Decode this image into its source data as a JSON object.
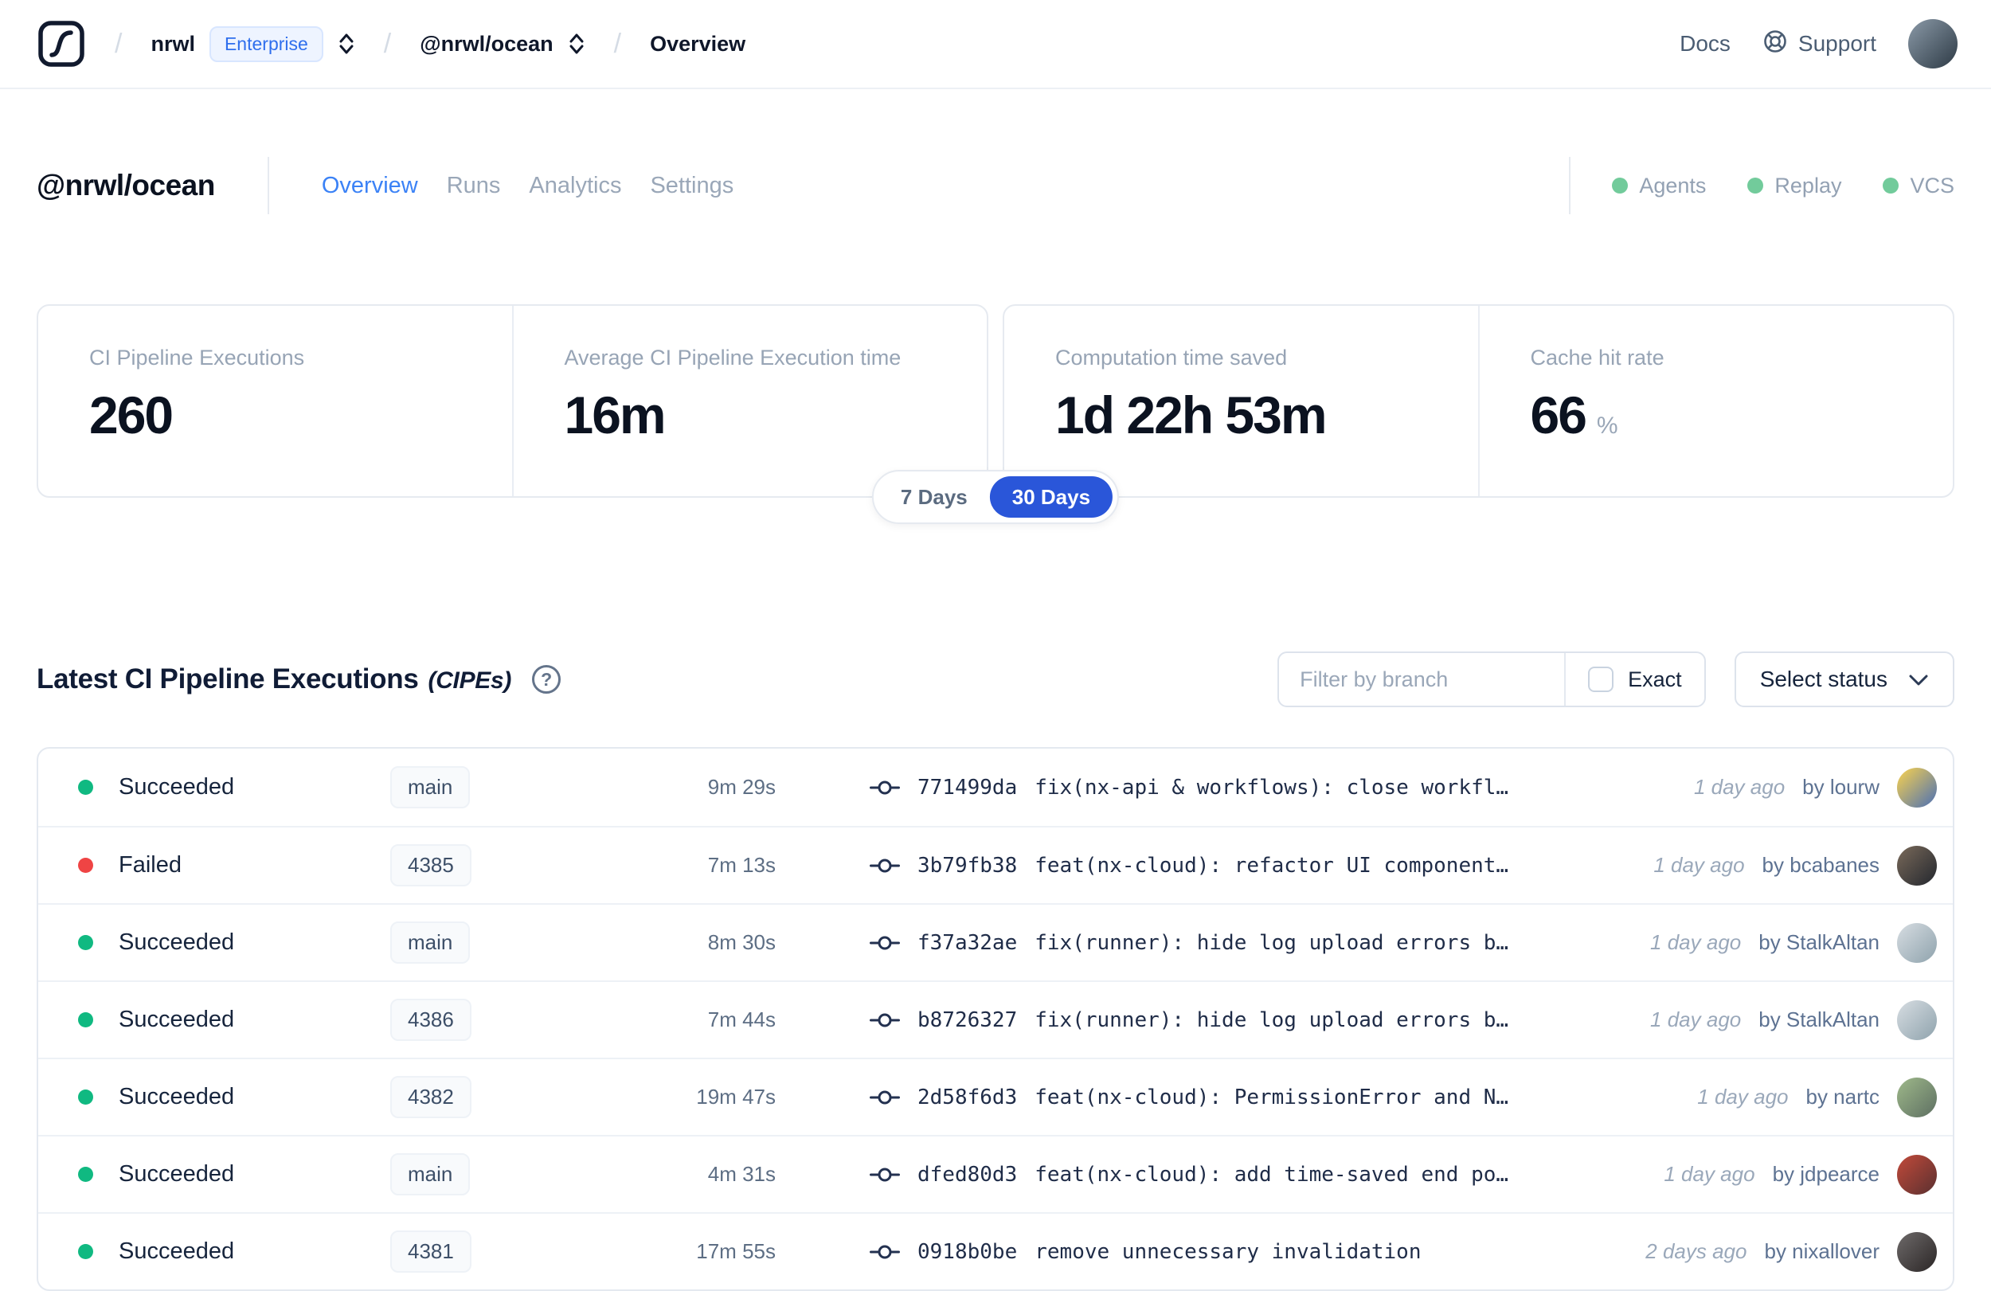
{
  "navbar": {
    "logo_name": "nx-cloud-logo",
    "breadcrumb": {
      "org": "nrwl",
      "org_badge": "Enterprise",
      "workspace": "@nrwl/ocean",
      "page": "Overview"
    },
    "docs_label": "Docs",
    "support_label": "Support",
    "avatar_from": "#8b9aa8",
    "avatar_to": "#2d3a45"
  },
  "header": {
    "title": "@nrwl/ocean",
    "tabs": [
      {
        "label": "Overview",
        "active": true
      },
      {
        "label": "Runs",
        "active": false
      },
      {
        "label": "Analytics",
        "active": false
      },
      {
        "label": "Settings",
        "active": false
      }
    ],
    "indicators": [
      {
        "label": "Agents",
        "color": "#72cb9b"
      },
      {
        "label": "Replay",
        "color": "#72cb9b"
      },
      {
        "label": "VCS",
        "color": "#72cb9b"
      }
    ]
  },
  "stats": {
    "cards": [
      {
        "label": "CI Pipeline Executions",
        "value": "260",
        "suffix": ""
      },
      {
        "label": "Average CI Pipeline Execution time",
        "value": "16m",
        "suffix": ""
      },
      {
        "label": "Computation time saved",
        "value": "1d 22h 53m",
        "suffix": ""
      },
      {
        "label": "Cache hit rate",
        "value": "66",
        "suffix": "%"
      }
    ],
    "range_toggle": {
      "options": [
        "7 Days",
        "30 Days"
      ],
      "selected": "30 Days",
      "selected_color": "#2a56d9"
    }
  },
  "cipe_section": {
    "title": "Latest CI Pipeline Executions",
    "title_suffix": "(CIPEs)",
    "filter_placeholder": "Filter by branch",
    "exact_label": "Exact",
    "exact_checked": false,
    "status_dropdown_label": "Select status"
  },
  "table": {
    "rows": [
      {
        "status": "Succeeded",
        "status_color": "#10b981",
        "branch": "main",
        "duration": "9m 29s",
        "commit_hash": "771499da",
        "commit_message": "fix(nx-api & workflows): close workfl…",
        "time_ago": "1 day ago",
        "author": "by lourw",
        "avatar_from": "#fbd34d",
        "avatar_to": "#4a6fb5"
      },
      {
        "status": "Failed",
        "status_color": "#ef4444",
        "branch": "4385",
        "duration": "7m 13s",
        "commit_hash": "3b79fb38",
        "commit_message": "feat(nx-cloud): refactor UI component…",
        "time_ago": "1 day ago",
        "author": "by bcabanes",
        "avatar_from": "#7a6a5a",
        "avatar_to": "#23272e"
      },
      {
        "status": "Succeeded",
        "status_color": "#10b981",
        "branch": "main",
        "duration": "8m 30s",
        "commit_hash": "f37a32ae",
        "commit_message": "fix(runner): hide log upload errors b…",
        "time_ago": "1 day ago",
        "author": "by StalkAltan",
        "avatar_from": "#d7dde2",
        "avatar_to": "#8fa3ad"
      },
      {
        "status": "Succeeded",
        "status_color": "#10b981",
        "branch": "4386",
        "duration": "7m 44s",
        "commit_hash": "b8726327",
        "commit_message": "fix(runner): hide log upload errors b…",
        "time_ago": "1 day ago",
        "author": "by StalkAltan",
        "avatar_from": "#d7dde2",
        "avatar_to": "#8fa3ad"
      },
      {
        "status": "Succeeded",
        "status_color": "#10b981",
        "branch": "4382",
        "duration": "19m 47s",
        "commit_hash": "2d58f6d3",
        "commit_message": "feat(nx-cloud): PermissionError and N…",
        "time_ago": "1 day ago",
        "author": "by nartc",
        "avatar_from": "#9fb98a",
        "avatar_to": "#5d6f62"
      },
      {
        "status": "Succeeded",
        "status_color": "#10b981",
        "branch": "main",
        "duration": "4m 31s",
        "commit_hash": "dfed80d3",
        "commit_message": "feat(nx-cloud): add time-saved end po…",
        "time_ago": "1 day ago",
        "author": "by jdpearce",
        "avatar_from": "#c24a3a",
        "avatar_to": "#5a3030"
      },
      {
        "status": "Succeeded",
        "status_color": "#10b981",
        "branch": "4381",
        "duration": "17m 55s",
        "commit_hash": "0918b0be",
        "commit_message": "remove unnecessary invalidation",
        "time_ago": "2 days ago",
        "author": "by nixallover",
        "avatar_from": "#6e6a6a",
        "avatar_to": "#2b2626"
      }
    ]
  }
}
